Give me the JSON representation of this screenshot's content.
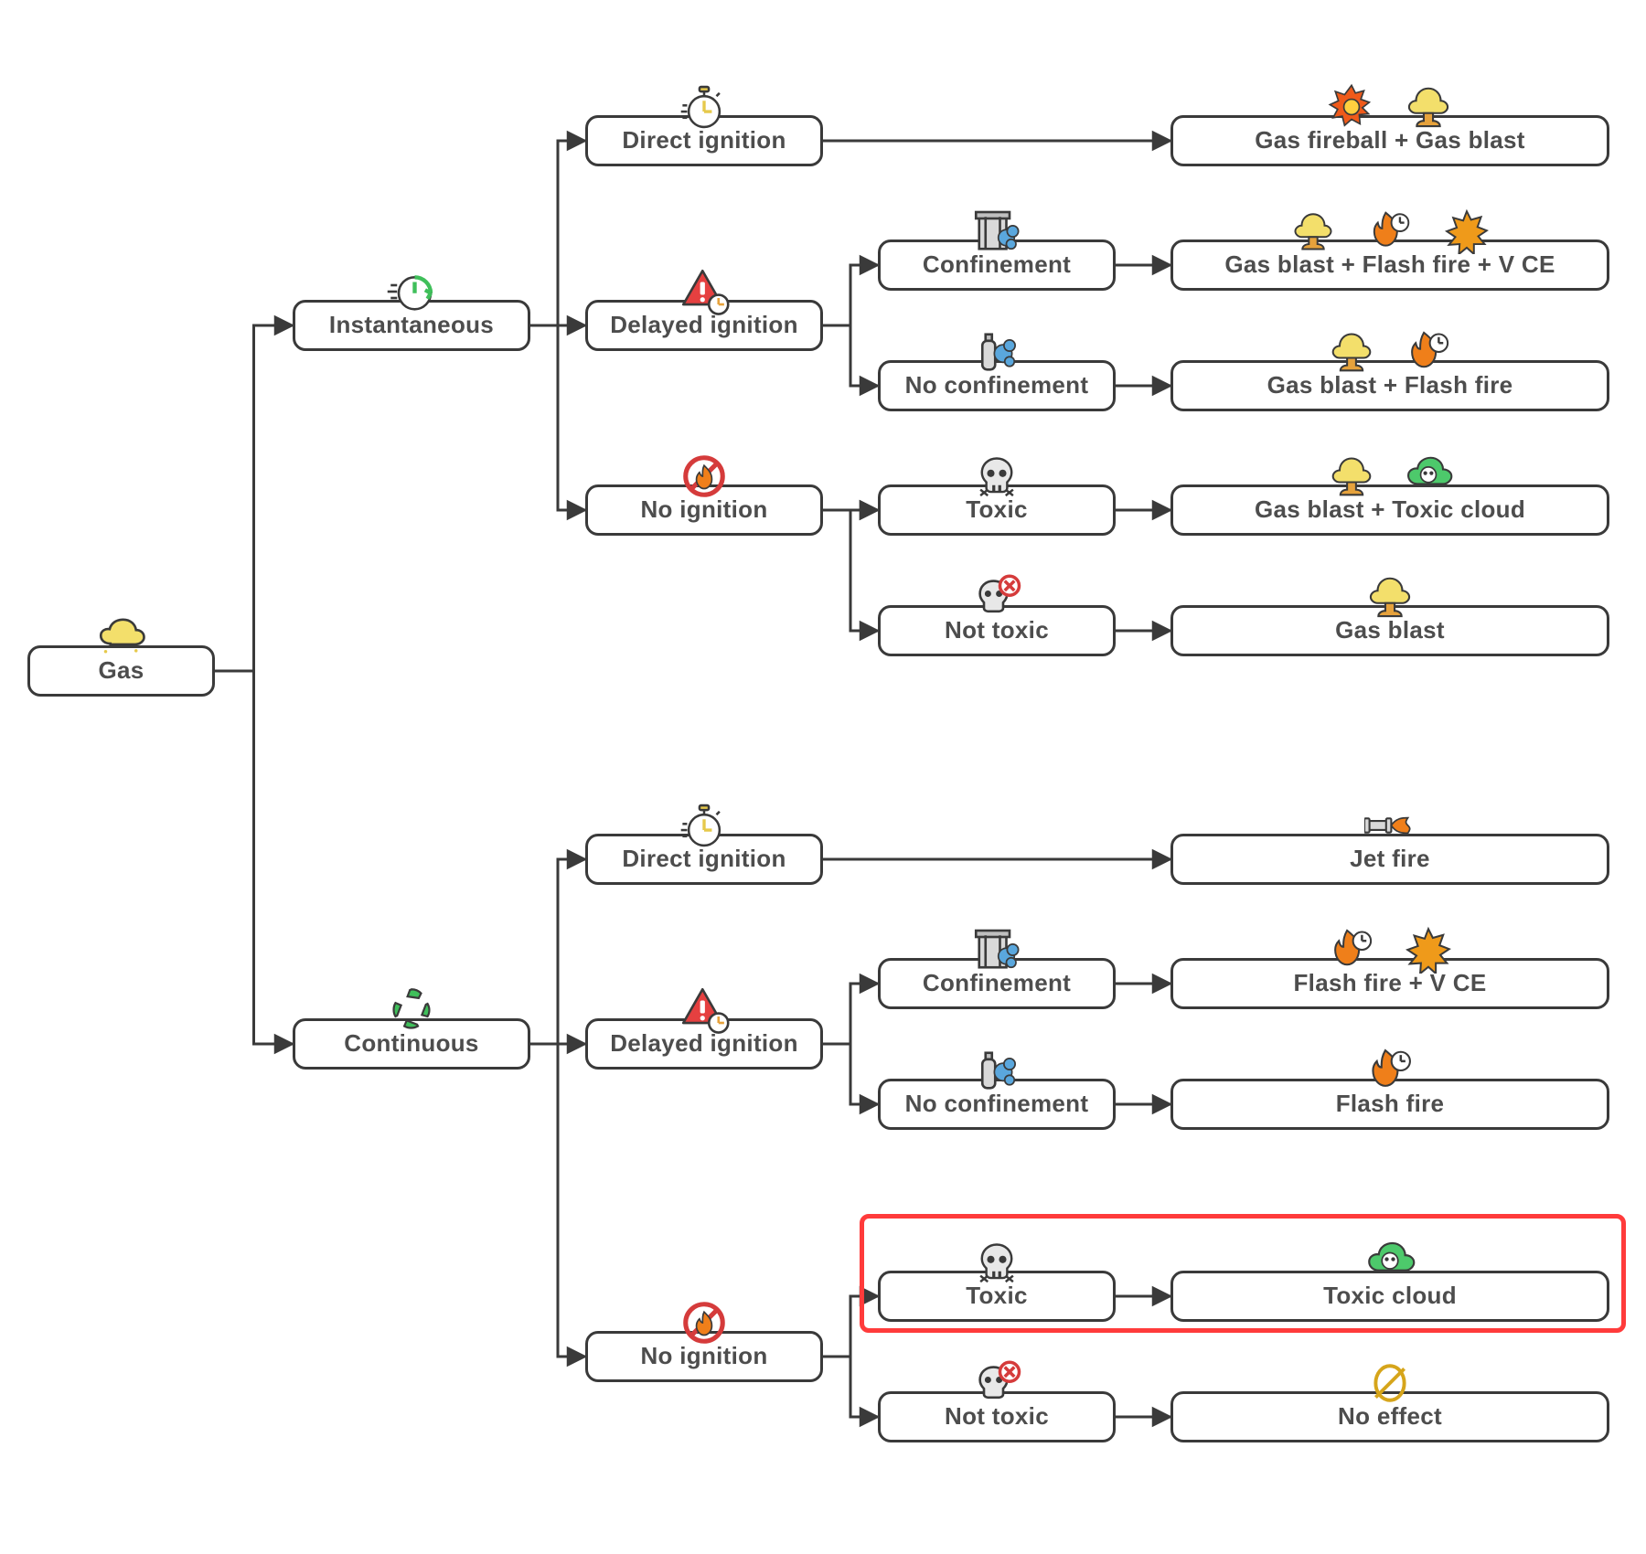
{
  "diagram": {
    "root": {
      "label": "Gas",
      "icon": "gas-cloud"
    },
    "releases": [
      {
        "label": "Instantaneous",
        "icon": "clock-arrow",
        "ignition": [
          {
            "label": "Direct ignition",
            "icon": "stopwatch",
            "outcomes": [
              {
                "label": "Gas fireball + Gas blast",
                "icons": [
                  "fireball",
                  "mushroom-cloud"
                ]
              }
            ]
          },
          {
            "label": "Delayed ignition",
            "icon": "alert-clock",
            "confinement": [
              {
                "label": "Confinement",
                "icon": "building-gas",
                "outcome": {
                  "label": "Gas blast + Flash fire + V CE",
                  "icons": [
                    "mushroom-cloud",
                    "flash-fire",
                    "explosion-star"
                  ]
                }
              },
              {
                "label": "No confinement",
                "icon": "cylinder-gas",
                "outcome": {
                  "label": "Gas blast + Flash fire",
                  "icons": [
                    "mushroom-cloud",
                    "flash-fire"
                  ]
                }
              }
            ]
          },
          {
            "label": "No ignition",
            "icon": "no-fire",
            "toxicity": [
              {
                "label": "Toxic",
                "icon": "skull",
                "outcome": {
                  "label": "Gas blast + Toxic cloud",
                  "icons": [
                    "mushroom-cloud",
                    "toxic-cloud"
                  ]
                }
              },
              {
                "label": "Not toxic",
                "icon": "skull-x",
                "outcome": {
                  "label": "Gas blast",
                  "icons": [
                    "mushroom-cloud"
                  ]
                }
              }
            ]
          }
        ]
      },
      {
        "label": "Continuous",
        "icon": "recycle",
        "ignition": [
          {
            "label": "Direct ignition",
            "icon": "stopwatch",
            "outcomes": [
              {
                "label": "Jet fire",
                "icons": [
                  "jet-fire"
                ]
              }
            ]
          },
          {
            "label": "Delayed ignition",
            "icon": "alert-clock",
            "confinement": [
              {
                "label": "Confinement",
                "icon": "building-gas",
                "outcome": {
                  "label": "Flash fire + V CE",
                  "icons": [
                    "flash-fire",
                    "explosion-star"
                  ]
                }
              },
              {
                "label": "No confinement",
                "icon": "cylinder-gas",
                "outcome": {
                  "label": "Flash fire",
                  "icons": [
                    "flash-fire"
                  ]
                }
              }
            ]
          },
          {
            "label": "No ignition",
            "icon": "no-fire",
            "toxicity": [
              {
                "label": "Toxic",
                "icon": "skull",
                "outcome": {
                  "label": "Toxic cloud",
                  "icons": [
                    "toxic-cloud"
                  ]
                },
                "highlight": true
              },
              {
                "label": "Not toxic",
                "icon": "skull-x",
                "outcome": {
                  "label": "No effect",
                  "icons": [
                    "no-effect"
                  ]
                }
              }
            ]
          }
        ]
      }
    ]
  },
  "highlight_color": "#ff3b3b"
}
